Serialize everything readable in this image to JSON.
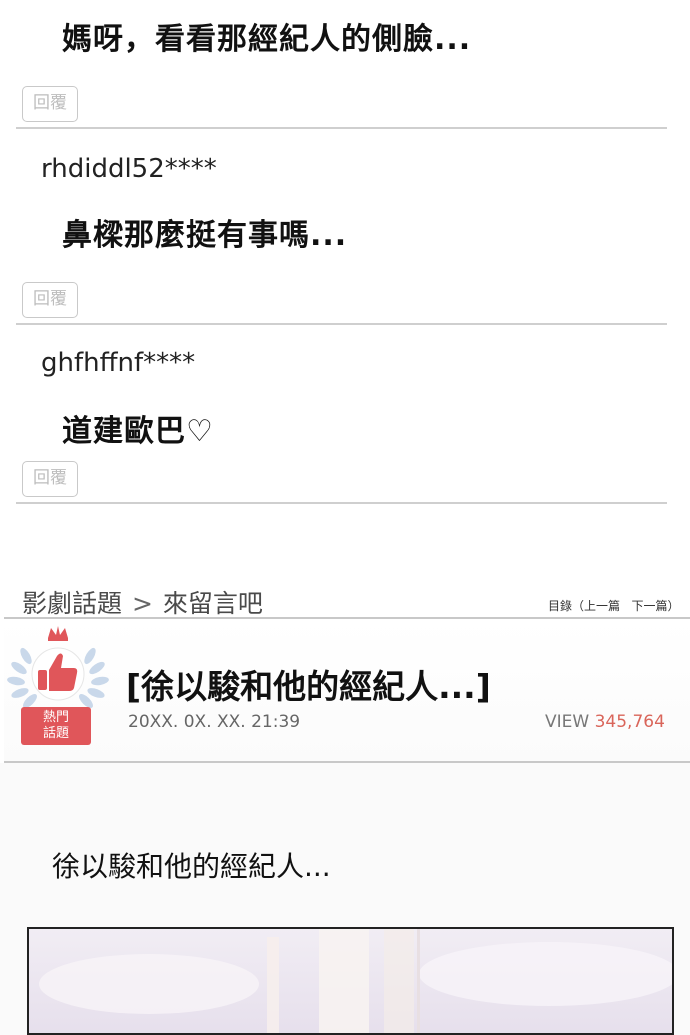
{
  "comments": [
    {
      "username": "",
      "text": "媽呀，看看那經紀人的側臉...",
      "reply_label": "回覆"
    },
    {
      "username": "rhdiddl52****",
      "text": "鼻樑那麼挺有事嗎...",
      "reply_label": "回覆"
    },
    {
      "username": "ghfhffnf****",
      "text": "道建歐巴♡",
      "reply_label": "回覆"
    }
  ],
  "breadcrumb": {
    "section": "影劇話題",
    "separator": ">",
    "board": "來留言吧"
  },
  "nav": {
    "directory": "目錄",
    "prev": "（上一篇",
    "next": "下一篇）"
  },
  "post": {
    "badge_line1": "熱門",
    "badge_line2": "話題",
    "title": "[徐以駿和他的經紀人...]",
    "date": "20XX. 0X. XX. 21:39",
    "view_label": "VIEW",
    "view_count": "345,764",
    "body": "徐以駿和他的經紀人..."
  },
  "colors": {
    "accent_red": "#e0565a",
    "view_count": "#d9655a",
    "laurel": "#c9d8ea"
  },
  "icons": {
    "badge": "thumbs-up-laurel-crown-icon"
  }
}
